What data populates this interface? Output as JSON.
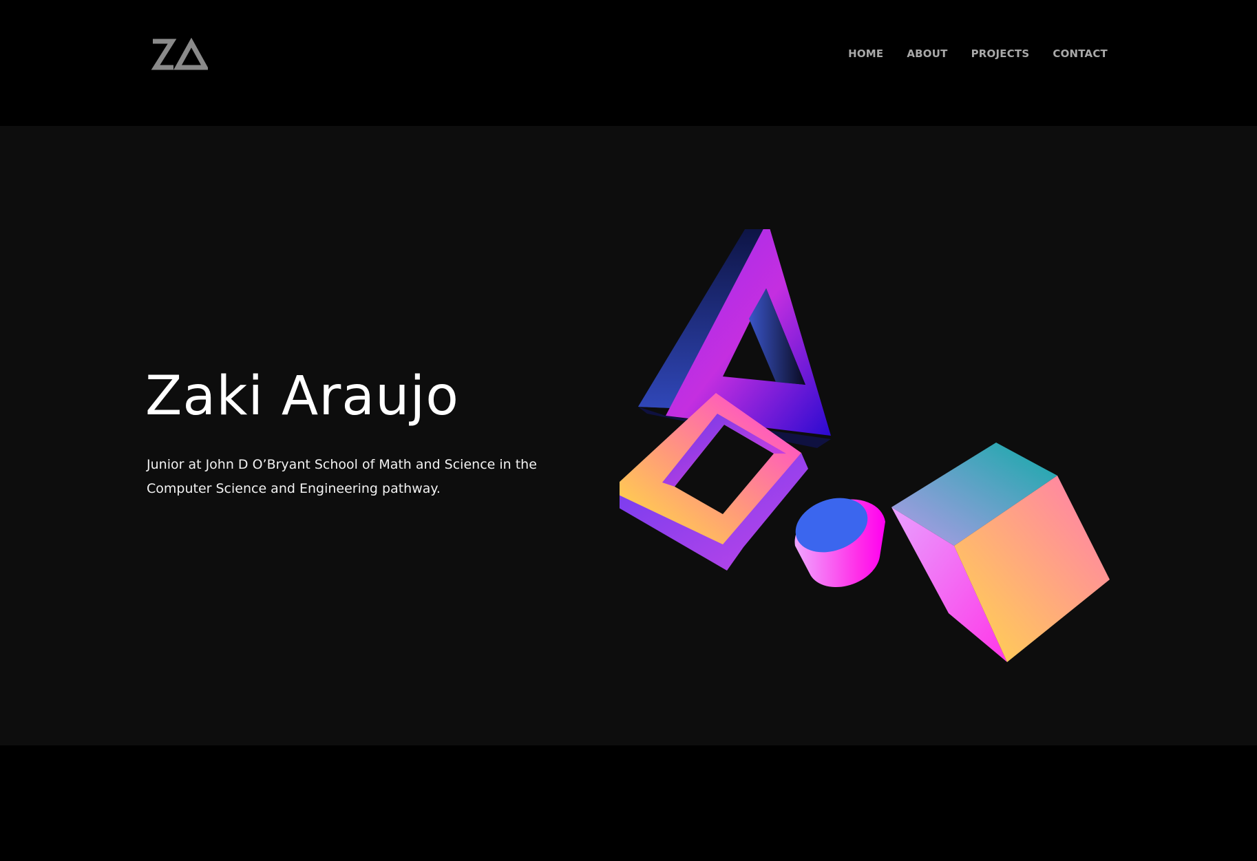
{
  "logo": {
    "text": "ZA",
    "icon": "za-monogram-icon"
  },
  "nav": {
    "items": [
      {
        "label": "HOME"
      },
      {
        "label": "ABOUT"
      },
      {
        "label": "PROJECTS"
      },
      {
        "label": "CONTACT"
      }
    ]
  },
  "hero": {
    "title": "Zaki Araujo",
    "description": "Junior at John D O’Bryant School of Math and Science in the Computer Science and Engineering pathway."
  },
  "colors": {
    "header_bg": "#000000",
    "hero_bg": "#0d0d0d",
    "nav_text": "#a9a9a9",
    "title_text": "#ffffff"
  },
  "illustration": {
    "icons": [
      "triangle-3d-icon",
      "square-frame-3d-icon",
      "cylinder-3d-icon",
      "cube-3d-icon"
    ]
  }
}
